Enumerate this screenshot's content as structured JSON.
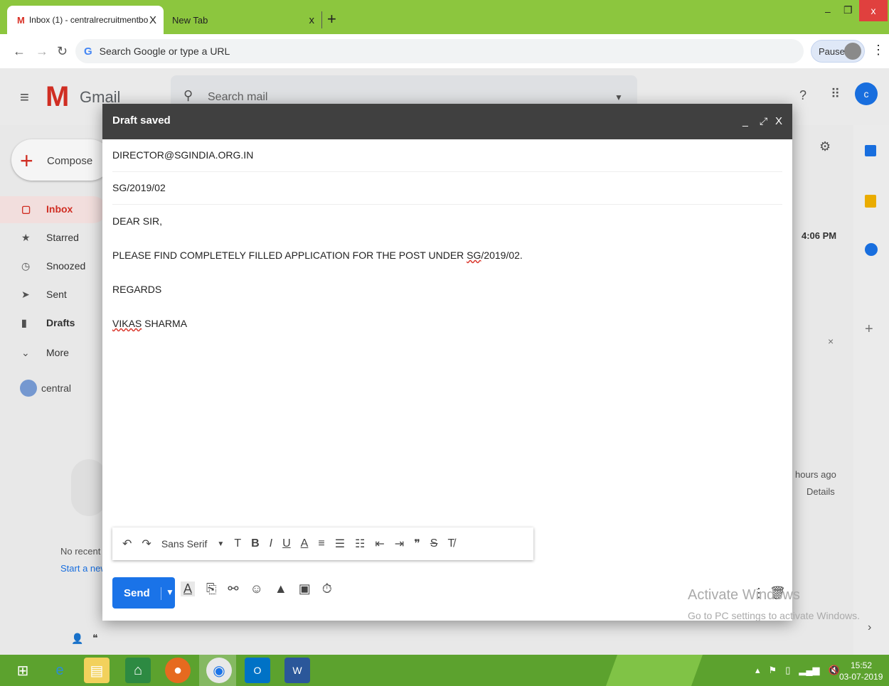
{
  "browser": {
    "tabs": [
      {
        "favicon": "M",
        "title": "Inbox (1) - centralrecruitmentbo",
        "close": "X"
      },
      {
        "title": "New Tab",
        "close": "x"
      }
    ],
    "new_tab": "+",
    "window": {
      "min": "–",
      "max": "❐",
      "close": "x"
    },
    "omnibox": {
      "g": "G",
      "placeholder": "Search Google or type a URL"
    },
    "profile": "Paused",
    "menu": "⋮"
  },
  "gmail": {
    "logo_m": "M",
    "title": "Gmail",
    "search_placeholder": "Search mail",
    "account_initial": "c",
    "compose_label": "Compose",
    "nav": [
      {
        "label": "Inbox",
        "icon": "▢"
      },
      {
        "label": "Starred",
        "icon": "★"
      },
      {
        "label": "Snoozed",
        "icon": "◷"
      },
      {
        "label": "Sent",
        "icon": "➤"
      },
      {
        "label": "Drafts",
        "icon": "▮"
      },
      {
        "label": "More",
        "icon": "⌄"
      }
    ],
    "account_name": "central",
    "no_recent": "No recent c",
    "start_new": "Start a new",
    "time": "4:06 PM",
    "hours_ago": "hours ago",
    "details": "Details"
  },
  "compose": {
    "header_title": "Draft saved",
    "controls": {
      "min": "_",
      "expand": "⤢",
      "close": "X"
    },
    "to": "DIRECTOR@SGINDIA.ORG.IN",
    "subject": "SG/2019/02",
    "body": {
      "greeting": "DEAR SIR,",
      "line1_pre": "PLEASE FIND COMPLETELY FILLED APPLICATION FOR THE POST UNDER ",
      "line1_word": "SG",
      "line1_post": "/2019/02.",
      "closing": "REGARDS",
      "sign_first": "VIKAS",
      "sign_last": " SHARMA"
    },
    "format_bar": {
      "font": "Sans Serif"
    },
    "send_label": "Send"
  },
  "watermark": {
    "line1": "Activate Windows",
    "line2": "Go to PC settings to activate Windows."
  },
  "taskbar": {
    "clock_time": "15:52",
    "clock_date": "03-07-2019"
  },
  "colors": {
    "gmail_red": "#d93025",
    "send_blue": "#1a73e8",
    "chrome_green": "#8cc63e",
    "taskbar_green": "#5ca22e"
  }
}
